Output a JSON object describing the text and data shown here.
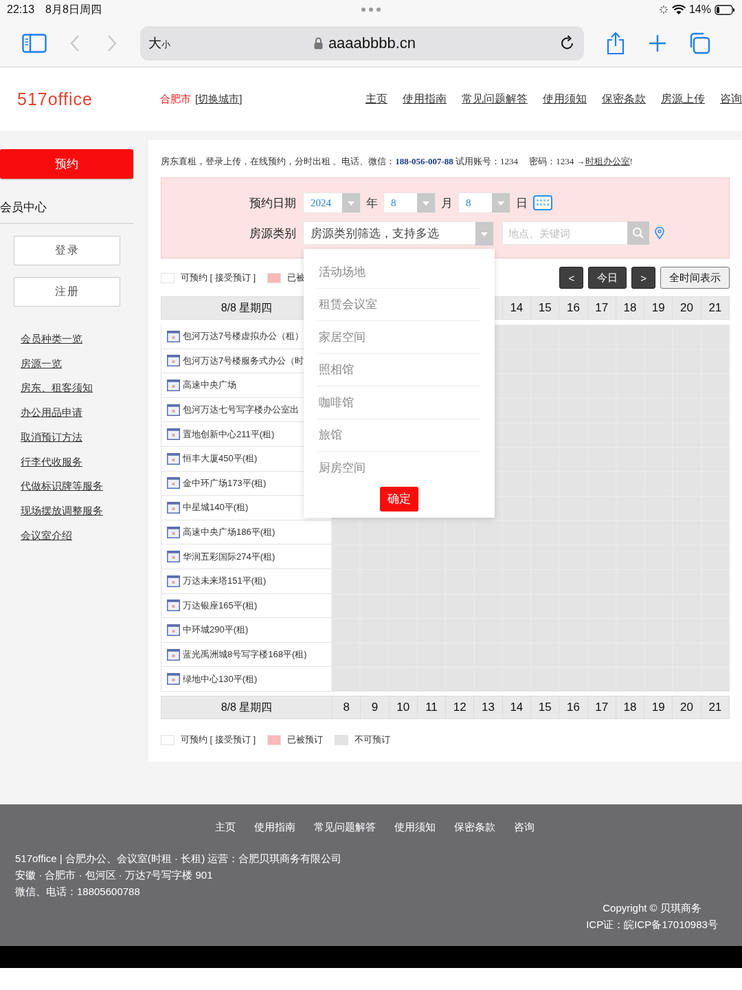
{
  "status_bar": {
    "time": "22:13",
    "date": "8月8日周四",
    "battery": "14%"
  },
  "browser": {
    "text_size": "大小",
    "url": "aaaabbbb.cn"
  },
  "site_header": {
    "logo": "517office",
    "city": "合肥市",
    "switch_city": "[切换城市]",
    "nav": [
      "主页",
      "使用指南",
      "常见问题解答",
      "使用须知",
      "保密条款",
      "房源上传",
      "咨询"
    ]
  },
  "sidebar": {
    "book_button": "预约",
    "member_title": "会员中心",
    "buttons": [
      "登录",
      "注册"
    ],
    "links": [
      "会员种类一览",
      "房源一览",
      "房东、租客须知",
      "办公用品申请",
      "取消预订方法",
      "行李代收服务",
      "代做标识牌等服务",
      "现场摆放调整服务",
      "会议室介绍"
    ]
  },
  "booking": {
    "notice": {
      "text": "房东直租，登录上传，在线预约，分时出租 。电话、微信：**188-056-007-88** 试用账号：1234　 密码：1234 →",
      "link": "时租办公室",
      "end": "!"
    },
    "filters": {
      "date_label": "预约日期",
      "year": "2024",
      "year_unit": "年",
      "month": "8",
      "month_unit": "月",
      "day": "8",
      "day_unit": "日",
      "category_label": "房源类别",
      "category_placeholder": "房源类别筛选，支持多选",
      "search_placeholder": "地点、关键词"
    },
    "legend_top": [
      {
        "label": "可预约 [ 接受预订 ]",
        "color": "#ffffff"
      },
      {
        "label": "已被",
        "color": "#f8b9b9"
      }
    ],
    "nav_buttons": [
      {
        "label": "<",
        "kind": "dark"
      },
      {
        "label": "今日",
        "kind": "dark"
      },
      {
        "label": ">",
        "kind": "dark"
      },
      {
        "label": "全时间表示",
        "kind": "light"
      }
    ],
    "header_top": {
      "day": "8/8 星期四",
      "hours": [
        "14",
        "15",
        "16",
        "17",
        "18",
        "19",
        "20",
        "21"
      ]
    },
    "rooms": [
      "包河万达7号楼虚拟办公（租）",
      "包河万达7号楼服务式办公（时",
      "高速中央广场",
      "包河万达七号写字楼办公室出",
      "置地创新中心211平(租)",
      "恒丰大厦450平(租)",
      "金中环广场173平(租)",
      "中星城140平(租)",
      "高速中央广场186平(租)",
      "华润五彩国际274平(租)",
      "万达未来塔151平(租)",
      "万达银座165平(租)",
      "中环城290平(租)",
      "蓝光禹洲城8号写字楼168平(租)",
      "绿地中心130平(租)"
    ],
    "header_bottom": {
      "day": "8/8 星期四",
      "hours": [
        "8",
        "9",
        "10",
        "11",
        "12",
        "13",
        "14",
        "15",
        "16",
        "17",
        "18",
        "19",
        "20",
        "21"
      ]
    },
    "legend_bottom": [
      {
        "label": "可预约 [ 接受预订 ]",
        "color": "#ffffff"
      },
      {
        "label": "已被预订",
        "color": "#f8b9b9"
      },
      {
        "label": "不可预订",
        "color": "#e3e3e3"
      }
    ],
    "category_dropdown": {
      "options": [
        {
          "label": "活动场地",
          "selected": false
        },
        {
          "label": "租赁会议室",
          "selected": false
        },
        {
          "label": "家居空间",
          "selected": false
        },
        {
          "label": "照相馆",
          "selected": false
        },
        {
          "label": "咖啡馆",
          "selected": false
        },
        {
          "label": "旅馆",
          "selected": false
        },
        {
          "label": "厨房空间",
          "selected": false
        }
      ],
      "confirm": "确定"
    }
  },
  "footer": {
    "nav": [
      "主页",
      "使用指南",
      "常见问题解答",
      "使用须知",
      "保密条款",
      "咨询"
    ],
    "lines": [
      "517office | 合肥办公、会议室(时租 · 长租) 运营：合肥贝琪商务有限公司",
      "安徽 · 合肥市 · 包河区 · 万达7号写字楼 901",
      "微信、电话：18805600788"
    ],
    "copyright": "Copyright © 贝琪商务",
    "icp": "ICP证：皖ICP备17010983号"
  }
}
